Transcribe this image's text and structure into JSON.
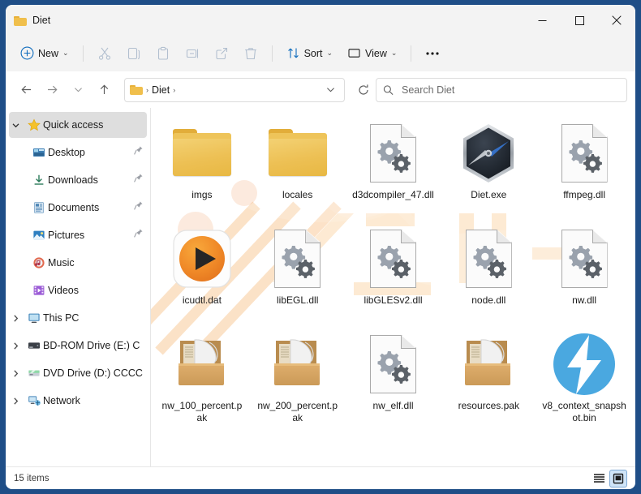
{
  "window": {
    "title": "Diet",
    "icon": "folder-icon",
    "border_color": "#1f4e87",
    "minimize_label": "Minimize",
    "maximize_label": "Maximize",
    "close_label": "Close"
  },
  "toolbar": {
    "new_label": "New",
    "new_icon": "plus-circle-icon",
    "cut_icon": "scissors-icon",
    "copy_icon": "copy-icon",
    "paste_icon": "clipboard-icon",
    "rename_icon": "rename-icon",
    "share_icon": "share-icon",
    "delete_icon": "trash-icon",
    "sort_label": "Sort",
    "sort_icon": "sort-arrows-icon",
    "view_label": "View",
    "view_icon": "monitor-icon",
    "more_label": "See more",
    "more_icon": "ellipsis-icon",
    "chevron": "⌄"
  },
  "addressbar": {
    "back_icon": "arrow-left-icon",
    "forward_icon": "arrow-right-icon",
    "recent_icon": "chevron-down-icon",
    "up_icon": "arrow-up-icon",
    "folder_icon": "folder-icon",
    "crumbs": [
      "Diet"
    ],
    "separator": "›",
    "dropdown_icon": "chevron-down-icon",
    "refresh_icon": "refresh-icon"
  },
  "search": {
    "icon": "search-icon",
    "placeholder": "Search Diet",
    "value": ""
  },
  "sidebar": {
    "items": [
      {
        "label": "Quick access",
        "icon": "star-icon",
        "expander": "chevron-down",
        "selected": true,
        "indent": 0,
        "pinned": false
      },
      {
        "label": "Desktop",
        "icon": "desktop-icon",
        "expander": "none",
        "selected": false,
        "indent": 1,
        "pinned": true
      },
      {
        "label": "Downloads",
        "icon": "download-icon",
        "expander": "none",
        "selected": false,
        "indent": 1,
        "pinned": true
      },
      {
        "label": "Documents",
        "icon": "documents-icon",
        "expander": "none",
        "selected": false,
        "indent": 1,
        "pinned": true
      },
      {
        "label": "Pictures",
        "icon": "pictures-icon",
        "expander": "none",
        "selected": false,
        "indent": 1,
        "pinned": true
      },
      {
        "label": "Music",
        "icon": "music-icon",
        "expander": "none",
        "selected": false,
        "indent": 1,
        "pinned": false
      },
      {
        "label": "Videos",
        "icon": "videos-icon",
        "expander": "none",
        "selected": false,
        "indent": 1,
        "pinned": false
      },
      {
        "label": "This PC",
        "icon": "this-pc-icon",
        "expander": "chevron-right",
        "selected": false,
        "indent": 0,
        "pinned": false
      },
      {
        "label": "BD-ROM Drive (E:) C",
        "icon": "bd-rom-drive-icon",
        "expander": "chevron-right",
        "selected": false,
        "indent": 0,
        "pinned": false
      },
      {
        "label": "DVD Drive (D:) CCCC",
        "icon": "dvd-drive-icon",
        "expander": "chevron-right",
        "selected": false,
        "indent": 0,
        "pinned": false
      },
      {
        "label": "Network",
        "icon": "network-icon",
        "expander": "chevron-right",
        "selected": false,
        "indent": 0,
        "pinned": false
      }
    ]
  },
  "files": [
    {
      "name": "imgs",
      "type": "folder",
      "icon": "folder-icon"
    },
    {
      "name": "locales",
      "type": "folder",
      "icon": "folder-icon"
    },
    {
      "name": "d3dcompiler_47.dll",
      "type": "dll",
      "icon": "dll-gears-icon"
    },
    {
      "name": "Diet.exe",
      "type": "exe",
      "icon": "diet-compass-icon"
    },
    {
      "name": "ffmpeg.dll",
      "type": "dll",
      "icon": "dll-gears-icon"
    },
    {
      "name": "icudtl.dat",
      "type": "dat",
      "icon": "orange-play-icon"
    },
    {
      "name": "libEGL.dll",
      "type": "dll",
      "icon": "dll-gears-icon"
    },
    {
      "name": "libGLESv2.dll",
      "type": "dll",
      "icon": "dll-gears-icon"
    },
    {
      "name": "node.dll",
      "type": "dll",
      "icon": "dll-gears-icon"
    },
    {
      "name": "nw.dll",
      "type": "dll",
      "icon": "dll-gears-icon"
    },
    {
      "name": "nw_100_percent.pak",
      "type": "pak",
      "icon": "open-box-icon"
    },
    {
      "name": "nw_200_percent.pak",
      "type": "pak",
      "icon": "open-box-icon"
    },
    {
      "name": "nw_elf.dll",
      "type": "dll",
      "icon": "dll-gears-icon"
    },
    {
      "name": "resources.pak",
      "type": "pak",
      "icon": "open-box-icon"
    },
    {
      "name": "v8_context_snapshot.bin",
      "type": "bin",
      "icon": "blue-bolt-icon"
    }
  ],
  "statusbar": {
    "item_count": "15 items",
    "list_view_icon": "list-view-icon",
    "details_view_icon": "large-icons-view-icon",
    "active_view": "large-icons-view-icon"
  },
  "colors": {
    "window_border": "#1f4e87",
    "titlebar_bg": "#f3f3f3",
    "accent_blue": "#0f6cbd",
    "folder_yellow": "#edc054",
    "selection_grey": "#dedede",
    "watermark_orange": "#f7a13d"
  }
}
